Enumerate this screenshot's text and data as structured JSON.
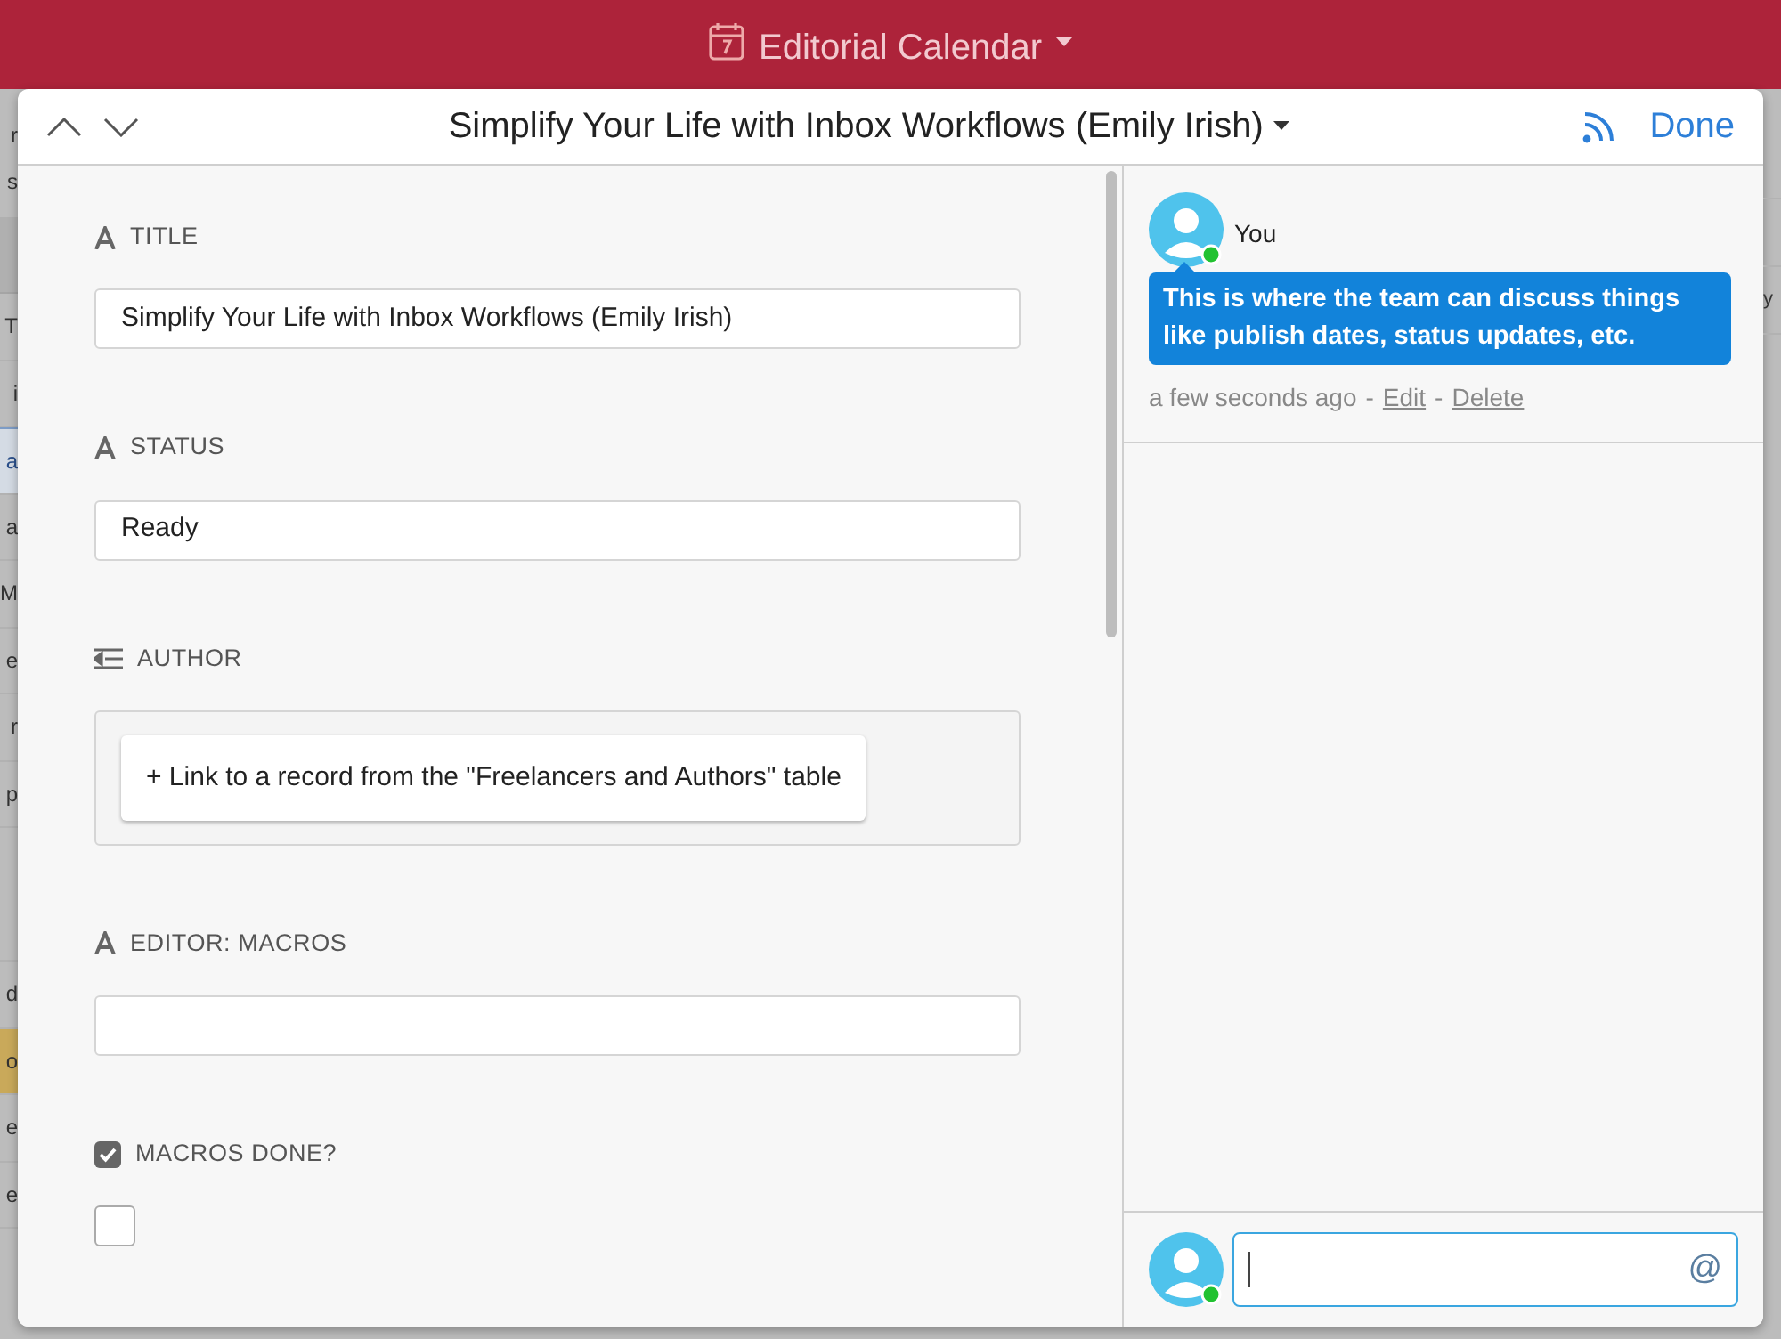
{
  "app": {
    "title": "Editorial Calendar"
  },
  "background": {
    "left_top": [
      "r",
      "s"
    ],
    "left_upper": [
      {
        "text": "T",
        "selected": false,
        "highlighted": false
      },
      {
        "text": "i",
        "selected": false,
        "highlighted": false
      },
      {
        "text": "a",
        "selected": true,
        "highlighted": false
      },
      {
        "text": "a",
        "selected": false,
        "highlighted": false
      },
      {
        "text": "M",
        "selected": false,
        "highlighted": false
      },
      {
        "text": "e",
        "selected": false,
        "highlighted": false
      },
      {
        "text": "r",
        "selected": false,
        "highlighted": false
      },
      {
        "text": "p",
        "selected": false,
        "highlighted": false
      }
    ],
    "left_lower": [
      {
        "text": "d",
        "selected": false,
        "highlighted": false
      },
      {
        "text": "o",
        "selected": false,
        "highlighted": true
      },
      {
        "text": "e",
        "selected": false,
        "highlighted": false
      },
      {
        "text": "e",
        "selected": false,
        "highlighted": false
      }
    ],
    "right_cells": [
      "y"
    ]
  },
  "record": {
    "title": "Simplify Your Life with Inbox Workflows (Emily Irish)",
    "done": "Done",
    "fields": [
      {
        "kind": "text",
        "label": "TITLE",
        "value": "Simplify Your Life with Inbox Workflows (Emily Irish)"
      },
      {
        "kind": "text",
        "label": "STATUS",
        "value": "Ready"
      },
      {
        "kind": "link",
        "label": "AUTHOR",
        "button": "+ Link to a record from the \"Freelancers and Authors\" table"
      },
      {
        "kind": "text",
        "label": "EDITOR: MACROS"
      },
      {
        "kind": "checkbox",
        "label": "MACROS DONE?",
        "checked": false
      }
    ]
  },
  "comments": [
    {
      "author": "You",
      "text": "This is where the team can discuss things like publish dates, status updates, etc.",
      "time": "a few seconds ago",
      "separator": "-",
      "actions": [
        "Edit",
        "Delete"
      ]
    }
  ],
  "composer": {
    "mention_symbol": "@"
  }
}
